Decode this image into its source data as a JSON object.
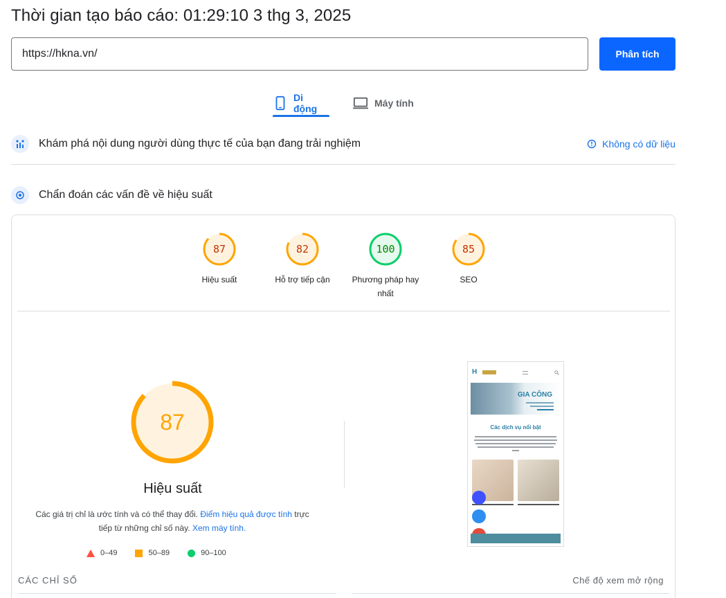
{
  "header": {
    "report_time": "Thời gian tạo báo cáo: 01:29:10 3 thg 3, 2025"
  },
  "search": {
    "url_value": "https://hkna.vn/",
    "analyze_label": "Phân tích"
  },
  "tabs": [
    {
      "label": "Di động",
      "icon": "mobile-icon",
      "active": true
    },
    {
      "label": "Máy tính",
      "icon": "laptop-icon",
      "active": false
    }
  ],
  "field_data": {
    "title": "Khám phá nội dung người dùng thực tế của bạn đang trải nghiệm",
    "no_data_label": "Không có dữ liệu"
  },
  "diagnose": {
    "title": "Chẩn đoán các vấn đề về hiệu suất"
  },
  "scores": [
    {
      "value": "87",
      "label": "Hiệu suất",
      "level": "average"
    },
    {
      "value": "82",
      "label": "Hỗ trợ tiếp cận",
      "level": "average"
    },
    {
      "value": "100",
      "label": "Phương pháp hay nhất",
      "level": "pass"
    },
    {
      "value": "85",
      "label": "SEO",
      "level": "average"
    }
  ],
  "performance": {
    "score": "87",
    "score_fraction": 0.87,
    "title": "Hiệu suất",
    "disclaimer_1": "Các giá trị chỉ là ước tính và có thể thay đổi. ",
    "disclaimer_link_1": "Điểm hiệu quả được tính",
    "disclaimer_2": " trực tiếp từ những chỉ số này. ",
    "disclaimer_link_2": "Xem máy tính."
  },
  "legend": {
    "fail": "0–49",
    "average": "50–89",
    "pass": "90–100"
  },
  "metrics": {
    "heading": "CÁC CHỈ SỐ",
    "expand_label": "Chế độ xem mở rộng"
  },
  "phone_preview": {
    "banner_title": "GIA CÔNG",
    "section_title": "Các dịch vụ nổi bật"
  },
  "colors": {
    "accent": "#1a73e8",
    "button": "#0b66ff",
    "average": "#ffa400",
    "average_text": "#c33300",
    "pass": "#0cce6b",
    "pass_text": "#008800",
    "fail": "#ff4e42"
  }
}
